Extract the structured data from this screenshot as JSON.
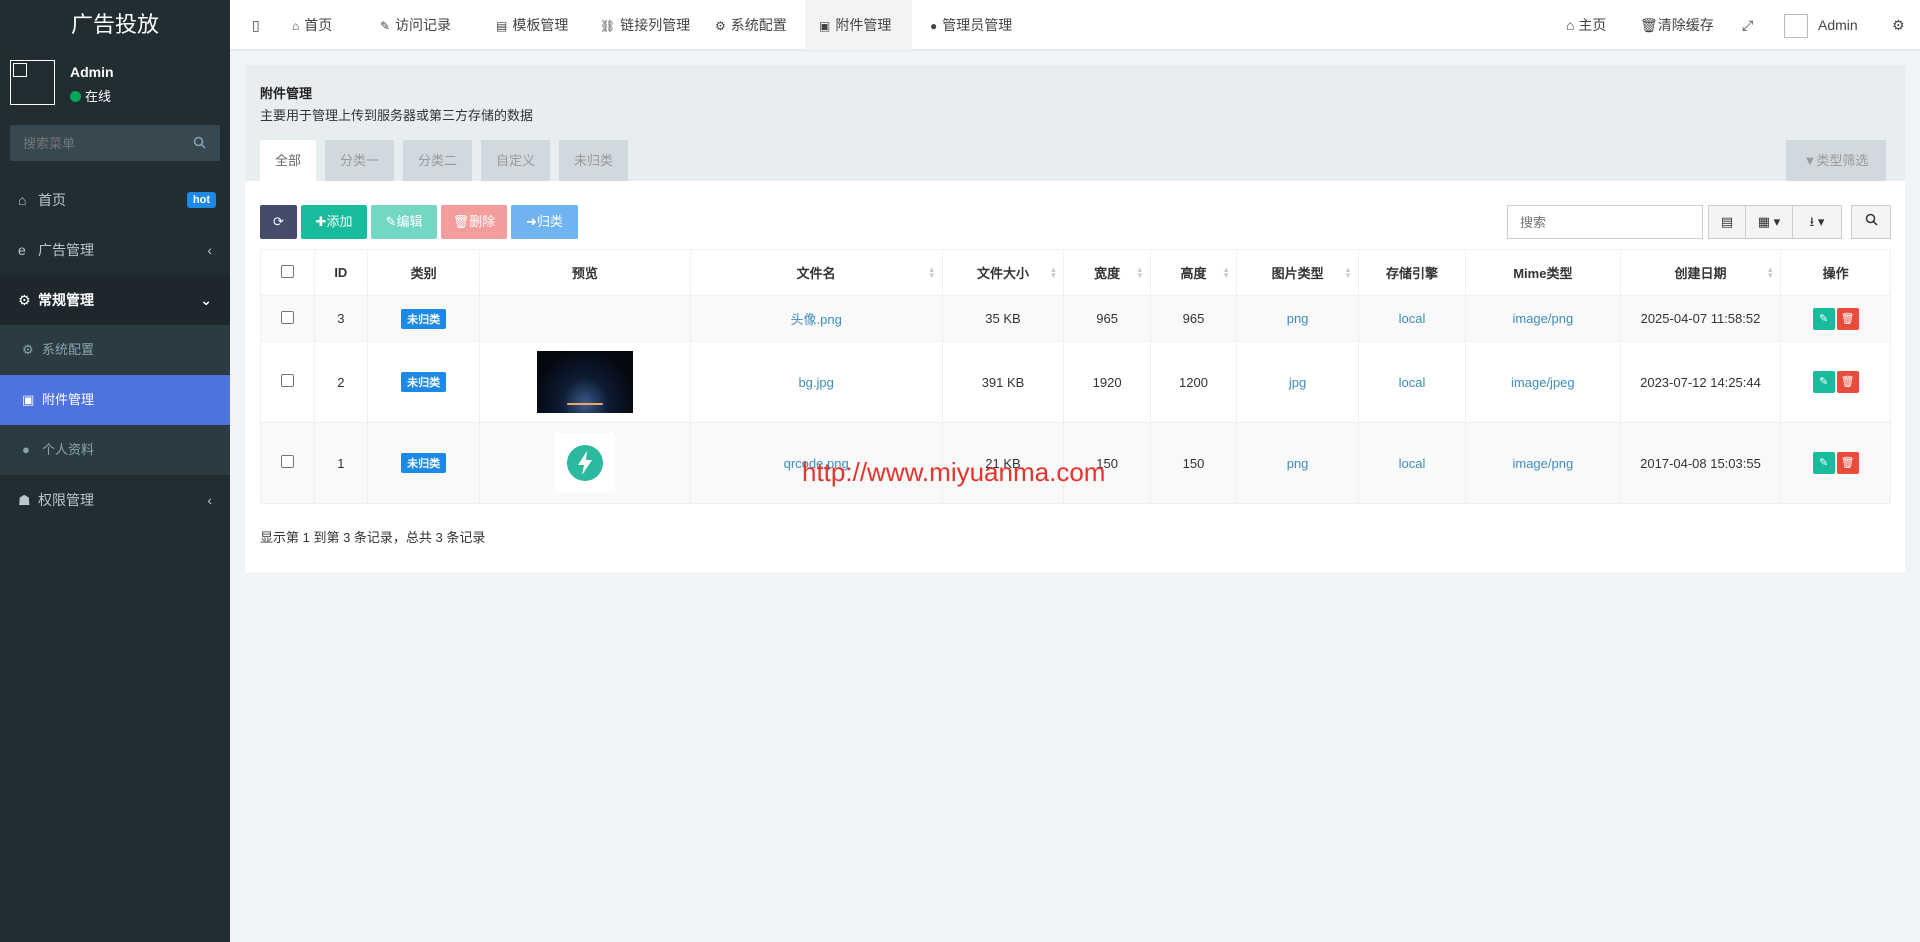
{
  "sidebar": {
    "brand": "广告投放",
    "user": {
      "name": "Admin",
      "status": "在线"
    },
    "search_placeholder": "搜索菜单",
    "menu": [
      {
        "label": "首页",
        "badge": "hot"
      },
      {
        "label": "广告管理"
      },
      {
        "label": "常规管理"
      },
      {
        "label": "权限管理"
      }
    ],
    "submenu": [
      {
        "label": "系统配置"
      },
      {
        "label": "附件管理"
      },
      {
        "label": "个人资料"
      }
    ]
  },
  "topbar": {
    "tabs": [
      "首页",
      "访问记录",
      "模板管理",
      "链接列管理",
      "系统配置",
      "附件管理",
      "管理员管理"
    ],
    "right": {
      "home": "主页",
      "clear": "清除缓存",
      "admin": "Admin"
    }
  },
  "panel": {
    "title": "附件管理",
    "desc": "主要用于管理上传到服务器或第三方存储的数据",
    "tabs": [
      "全部",
      "分类一",
      "分类二",
      "自定义",
      "未归类"
    ],
    "filter": "类型筛选"
  },
  "toolbar": {
    "add": "添加",
    "edit": "编辑",
    "delete": "删除",
    "classify": "归类",
    "search_placeholder": "搜索"
  },
  "table": {
    "headers": [
      "ID",
      "类别",
      "预览",
      "文件名",
      "文件大小",
      "宽度",
      "高度",
      "图片类型",
      "存储引擎",
      "Mime类型",
      "创建日期",
      "操作"
    ],
    "rows": [
      {
        "id": "3",
        "category": "未归类",
        "filename": "头像.png",
        "size": "35 KB",
        "width": "965",
        "height": "965",
        "type": "png",
        "engine": "local",
        "mime": "image/png",
        "date": "2025-04-07 11:58:52"
      },
      {
        "id": "2",
        "category": "未归类",
        "filename": "bg.jpg",
        "size": "391 KB",
        "width": "1920",
        "height": "1200",
        "type": "jpg",
        "engine": "local",
        "mime": "image/jpeg",
        "date": "2023-07-12 14:25:44"
      },
      {
        "id": "1",
        "category": "未归类",
        "filename": "qrcode.png",
        "size": "21 KB",
        "width": "150",
        "height": "150",
        "type": "png",
        "engine": "local",
        "mime": "image/png",
        "date": "2017-04-08 15:03:55"
      }
    ]
  },
  "pager": "显示第 1 到第 3 条记录，总共 3 条记录",
  "watermark": "http://www.miyuanma.com",
  "colors": {
    "sidebar": "#222d32",
    "active": "#4e73df",
    "success": "#18bc9c",
    "danger": "#e74c3c",
    "label": "#1e88e5"
  }
}
